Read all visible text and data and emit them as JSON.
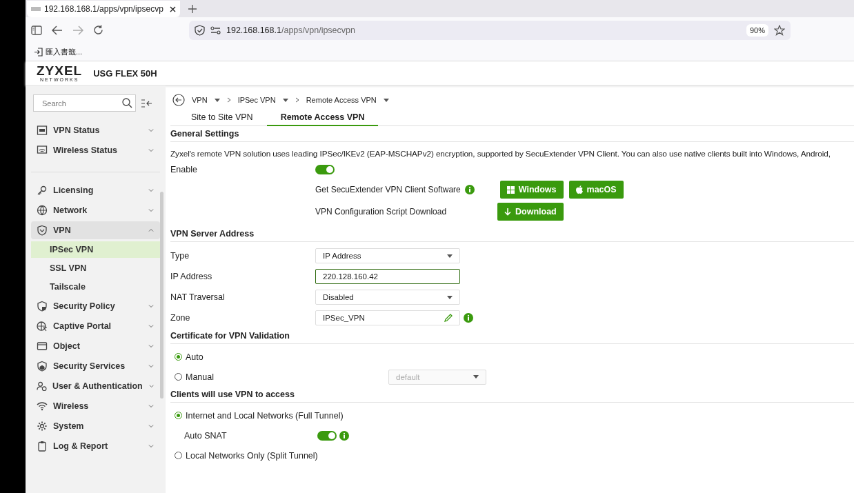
{
  "browser": {
    "tab_title": "192.168.168.1/apps/vpn/ipsecvp",
    "url_host": "192.168.168.1",
    "url_path": "/apps/vpn/ipsecvpn",
    "zoom": "90%",
    "bookmark": "匯入書籤..."
  },
  "header": {
    "logo": "ZYXEL",
    "logo_sub": "NETWORKS",
    "model": "USG FLEX 50H"
  },
  "sidebar": {
    "search": {
      "placeholder": "Search"
    },
    "status_items": [
      {
        "label": "VPN Status",
        "expanded": false
      },
      {
        "label": "Wireless Status",
        "expanded": false
      }
    ],
    "items": [
      {
        "label": "Licensing",
        "expanded": false
      },
      {
        "label": "Network",
        "expanded": false
      },
      {
        "label": "VPN",
        "expanded": true,
        "children": [
          {
            "label": "IPSec VPN",
            "selected": true
          },
          {
            "label": "SSL VPN",
            "selected": false
          },
          {
            "label": "Tailscale",
            "selected": false
          }
        ]
      },
      {
        "label": "Security Policy",
        "expanded": false
      },
      {
        "label": "Captive Portal",
        "expanded": false
      },
      {
        "label": "Object",
        "expanded": false
      },
      {
        "label": "Security Services",
        "expanded": false
      },
      {
        "label": "User & Authentication",
        "expanded": false
      },
      {
        "label": "Wireless",
        "expanded": false
      },
      {
        "label": "System",
        "expanded": false
      },
      {
        "label": "Log & Report",
        "expanded": false
      }
    ]
  },
  "breadcrumb": [
    "VPN",
    "IPSec VPN",
    "Remote Access VPN"
  ],
  "tabs": [
    {
      "label": "Site to Site VPN",
      "selected": false
    },
    {
      "label": "Remote Access VPN",
      "selected": true
    }
  ],
  "general": {
    "title": "General Settings",
    "description": "Zyxel's remote VPN solution uses leading IPSec/IKEv2 (EAP-MSCHAPv2) encryption, supported by SecuExtender VPN Client. You can also use native clients built into Windows, Android,",
    "enable_label": "Enable",
    "enable_on": true,
    "client_label": "Get SecuExtender VPN Client Software",
    "client_buttons": [
      {
        "label": "Windows",
        "kind": "windows"
      },
      {
        "label": "macOS",
        "kind": "apple"
      }
    ],
    "script_label": "VPN Configuration Script Download",
    "script_button": "Download"
  },
  "server": {
    "title": "VPN Server Address",
    "fields": [
      {
        "label": "Type",
        "kind": "select",
        "value": "IP Address"
      },
      {
        "label": "IP Address",
        "kind": "input",
        "value": "220.128.160.42"
      },
      {
        "label": "NAT Traversal",
        "kind": "select",
        "value": "Disabled"
      },
      {
        "label": "Zone",
        "kind": "zone",
        "value": "IPSec_VPN"
      }
    ]
  },
  "certificate": {
    "title": "Certificate for VPN Validation",
    "options": [
      {
        "label": "Auto",
        "selected": true
      },
      {
        "label": "Manual",
        "selected": false,
        "select": {
          "value": "default",
          "disabled": true
        }
      }
    ]
  },
  "clients": {
    "title": "Clients will use VPN to access",
    "options": [
      {
        "label": "Internet and Local Networks (Full Tunnel)",
        "selected": true,
        "snat": {
          "label": "Auto SNAT",
          "on": true
        }
      },
      {
        "label": "Local Networks Only (Split Tunnel)",
        "selected": false
      }
    ]
  }
}
